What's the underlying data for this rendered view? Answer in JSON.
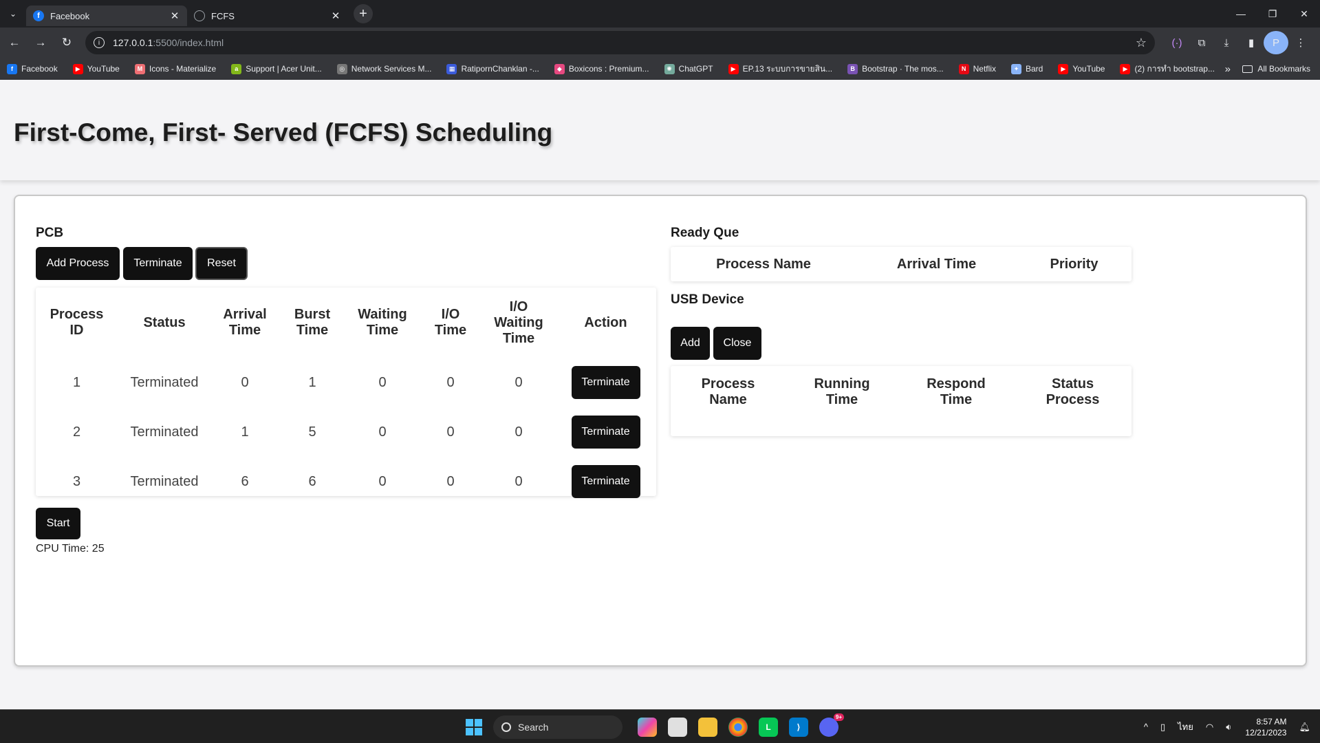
{
  "browser": {
    "tabs": [
      {
        "title": "Facebook",
        "active": true,
        "icon": "facebook-icon"
      },
      {
        "title": "FCFS",
        "active": false,
        "icon": "globe-icon"
      }
    ],
    "url_host": "127.0.0.1",
    "url_path": ":5500/index.html",
    "profile_initial": "P",
    "bookmarks": [
      {
        "label": "Facebook",
        "color": "#1877f2",
        "glyph": "f"
      },
      {
        "label": "YouTube",
        "color": "#ff0000",
        "glyph": "▶"
      },
      {
        "label": "Icons - Materialize",
        "color": "#ee6e73",
        "glyph": "M"
      },
      {
        "label": "Support | Acer Unit...",
        "color": "#83b81a",
        "glyph": "a"
      },
      {
        "label": "Network Services M...",
        "color": "#777777",
        "glyph": "◎"
      },
      {
        "label": "RatipornChanklan -...",
        "color": "#3b5bdb",
        "glyph": "▦"
      },
      {
        "label": "Boxicons : Premium...",
        "color": "#e64980",
        "glyph": "◆"
      },
      {
        "label": "ChatGPT",
        "color": "#74aa9c",
        "glyph": "✺"
      },
      {
        "label": "EP.13 ระบบการขายสิน...",
        "color": "#ff0000",
        "glyph": "▶"
      },
      {
        "label": "Bootstrap · The mos...",
        "color": "#7952b3",
        "glyph": "B"
      },
      {
        "label": "Netflix",
        "color": "#e50914",
        "glyph": "N"
      },
      {
        "label": "Bard",
        "color": "#8ab4f8",
        "glyph": "✦"
      },
      {
        "label": "YouTube",
        "color": "#ff0000",
        "glyph": "▶"
      },
      {
        "label": "(2) การทำ bootstrap...",
        "color": "#ff0000",
        "glyph": "▶"
      }
    ],
    "all_bookmarks": "All Bookmarks"
  },
  "page": {
    "title": "First-Come, First- Served (FCFS) Scheduling",
    "pcb": {
      "title": "PCB",
      "buttons": {
        "add": "Add Process",
        "terminate": "Terminate",
        "reset": "Reset"
      },
      "headers": [
        [
          "Process",
          "ID"
        ],
        [
          "Status"
        ],
        [
          "Arrival",
          "Time"
        ],
        [
          "Burst",
          "Time"
        ],
        [
          "Waiting",
          "Time"
        ],
        [
          "I/O",
          "Time"
        ],
        [
          "I/O",
          "Waiting",
          "Time"
        ],
        [
          "Action"
        ]
      ],
      "rows": [
        {
          "id": "1",
          "status": "Terminated",
          "arrival": "0",
          "burst": "1",
          "waiting": "0",
          "io": "0",
          "io_waiting": "0",
          "action": "Terminate"
        },
        {
          "id": "2",
          "status": "Terminated",
          "arrival": "1",
          "burst": "5",
          "waiting": "0",
          "io": "0",
          "io_waiting": "0",
          "action": "Terminate"
        },
        {
          "id": "3",
          "status": "Terminated",
          "arrival": "6",
          "burst": "6",
          "waiting": "0",
          "io": "0",
          "io_waiting": "0",
          "action": "Terminate"
        }
      ],
      "start_label": "Start",
      "cpu_time_label": "CPU Time: 25"
    },
    "ready_queue": {
      "title": "Ready Que",
      "headers": [
        "Process Name",
        "Arrival Time",
        "Priority"
      ]
    },
    "usb": {
      "title": "USB Device",
      "buttons": {
        "add": "Add",
        "close": "Close"
      },
      "headers": [
        [
          "Process",
          "Name"
        ],
        [
          "Running",
          "Time"
        ],
        [
          "Respond",
          "Time"
        ],
        [
          "Status",
          "Process"
        ]
      ]
    }
  },
  "taskbar": {
    "search_label": "Search",
    "lang": "ไทย",
    "time": "8:57 AM",
    "date": "12/21/2023",
    "discord_badge": "9+"
  }
}
